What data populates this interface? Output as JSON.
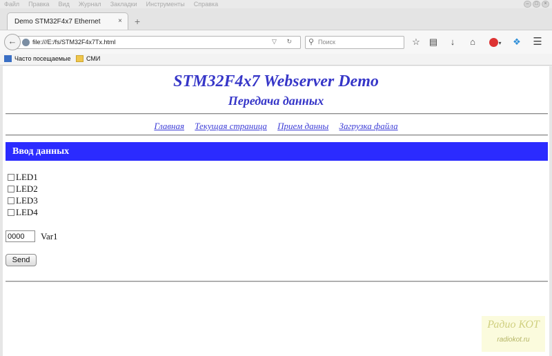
{
  "menubar": {
    "items": [
      "Файл",
      "Правка",
      "Вид",
      "Журнал",
      "Закладки",
      "Инструменты",
      "Справка"
    ]
  },
  "tab": {
    "title": "Demo STM32F4x7 Ethernet",
    "close": "×"
  },
  "newtab": "+",
  "navbar": {
    "back_icon": "arrow-left-icon",
    "url": "file:///E:/fs/STM32F4x7Tx.html",
    "url_icons": "▽ ↻",
    "search_placeholder": "Поиск"
  },
  "bookmarks": [
    {
      "label": "Часто посещаемые",
      "icon": "bookmark-app-icon"
    },
    {
      "label": "СМИ",
      "icon": "folder-icon"
    }
  ],
  "page": {
    "title": "STM32F4x7 Webserver Demo",
    "subtitle": "Передача данных",
    "nav_links": [
      "Главная",
      "Текущая страница",
      "Прием данны",
      "Загрузка файла"
    ],
    "section_title": "Ввод данных",
    "leds": [
      "LED1",
      "LED2",
      "LED3",
      "LED4"
    ],
    "var1_value": "0000",
    "var1_label": "Var1",
    "send_label": "Send"
  },
  "watermark": {
    "line1": "Радио КОТ",
    "line2": "radiokot.ru"
  },
  "colors": {
    "accent_blue": "#2b2bff",
    "heading": "#3636c8",
    "link": "#3b3bd6"
  }
}
